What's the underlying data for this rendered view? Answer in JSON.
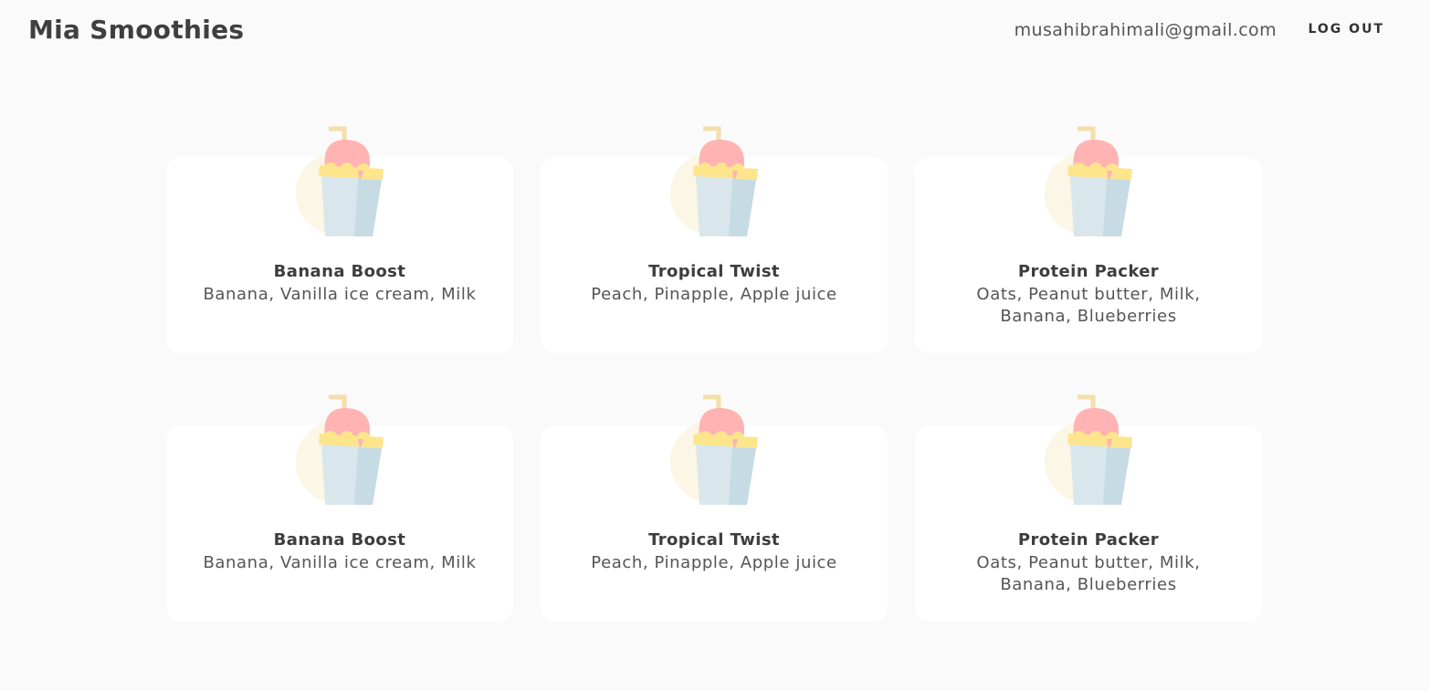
{
  "header": {
    "brand": "Mia Smoothies",
    "email": "musahibrahimali@gmail.com",
    "logout_label": "LOG OUT"
  },
  "icon": {
    "name": "smoothie-cup-icon",
    "colors": {
      "circle": "#fbf6e5",
      "straw": "#f3dfa9",
      "cream": "#ffb3b3",
      "rim": "#fde58c",
      "cup_light": "#d9e7ed",
      "cup_dark": "#c6dbe3"
    }
  },
  "smoothies": [
    {
      "title": "Banana Boost",
      "ingredients": "Banana, Vanilla ice cream, Milk"
    },
    {
      "title": "Tropical Twist",
      "ingredients": "Peach, Pinapple, Apple juice"
    },
    {
      "title": "Protein Packer",
      "ingredients": "Oats, Peanut butter, Milk, Banana, Blueberries"
    },
    {
      "title": "Banana Boost",
      "ingredients": "Banana, Vanilla ice cream, Milk"
    },
    {
      "title": "Tropical Twist",
      "ingredients": "Peach, Pinapple, Apple juice"
    },
    {
      "title": "Protein Packer",
      "ingredients": "Oats, Peanut butter, Milk, Banana, Blueberries"
    }
  ]
}
